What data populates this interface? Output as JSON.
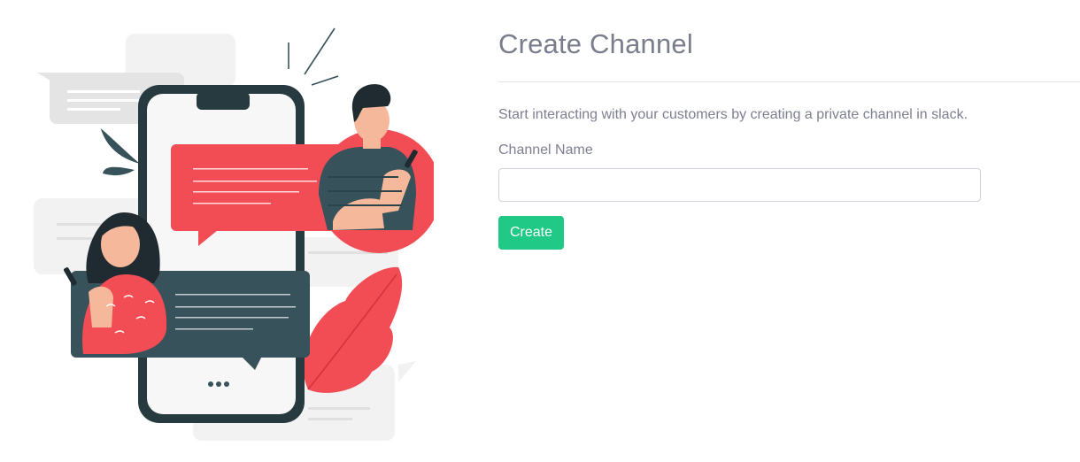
{
  "page": {
    "title": "Create Channel",
    "description": "Start interacting with your customers by creating a private channel in slack."
  },
  "form": {
    "channel_name_label": "Channel Name",
    "channel_name_value": "",
    "create_label": "Create"
  },
  "colors": {
    "accent_green": "#20c985",
    "bubble_red": "#f24c55",
    "bubble_dark": "#37525a",
    "text_gray": "#7d8091"
  },
  "illustration": {
    "name": "chat-illustration",
    "icons": [
      "phone-icon",
      "chat-bubble-icon",
      "person-icon",
      "leaf-icon"
    ]
  }
}
